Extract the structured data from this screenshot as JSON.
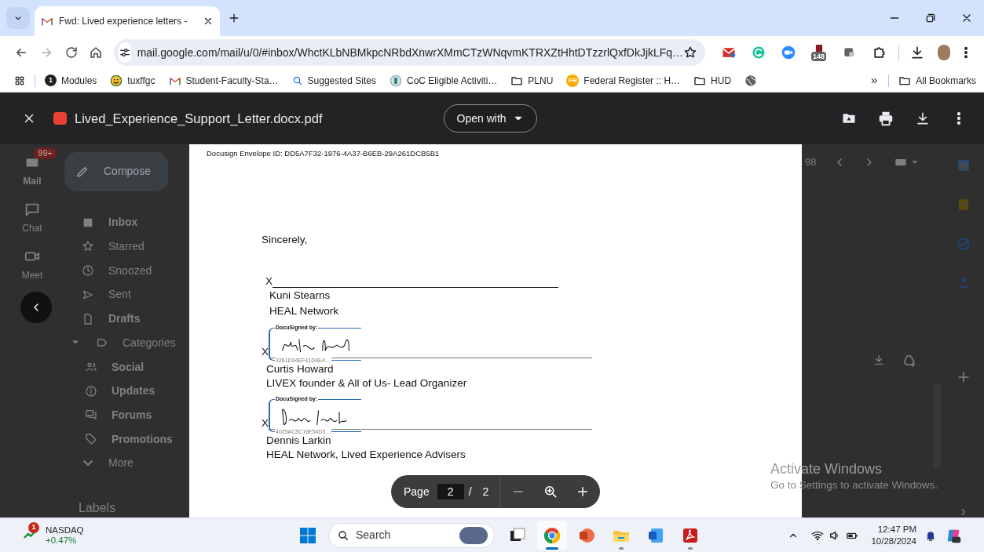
{
  "browser": {
    "tabs": [
      {
        "title": "Fwd: Lived experience letters -",
        "selected": true
      }
    ],
    "url": "mail.google.com/mail/u/0/#inbox/WhctKLbNBMkpcNRbdXnwrXMmCTzWNqvmKTRXZtHhtDTzzrlQxfDkJjkLFq…",
    "extensions": [
      {
        "kind": "mail"
      },
      {
        "kind": "grammarly"
      },
      {
        "kind": "zoom"
      },
      {
        "kind": "counter",
        "badge": "148"
      },
      {
        "kind": "tabs"
      },
      {
        "kind": "puzzle"
      }
    ],
    "bookmarks": [
      {
        "kind": "numbered",
        "icon_text": "1",
        "label": "Modules"
      },
      {
        "kind": "emoji",
        "label": "tuxffgc"
      },
      {
        "kind": "gmail",
        "label": "Student-Faculty-Sta…"
      },
      {
        "kind": "search",
        "label": "Suggested Sites"
      },
      {
        "kind": "site",
        "label": "CoC Eligible Activiti…"
      },
      {
        "kind": "folder",
        "label": "PLNU"
      },
      {
        "kind": "lettered",
        "icon_text": "FR",
        "label": "Federal Register :: H…"
      },
      {
        "kind": "folder",
        "label": "HUD"
      },
      {
        "kind": "globe"
      }
    ],
    "overflow": "»",
    "all_bookmarks": "All Bookmarks"
  },
  "viewer": {
    "filename": "Lived_Experience_Support_Letter.docx.pdf",
    "open_with": "Open with"
  },
  "gmail": {
    "rail": [
      {
        "kind": "mail",
        "label": "Mail",
        "badge": "99+"
      },
      {
        "kind": "chat",
        "label": "Chat"
      },
      {
        "kind": "meet",
        "label": "Meet"
      }
    ],
    "compose": "Compose",
    "nav": [
      {
        "kind": "inbox",
        "label": "Inbox",
        "unread": true
      },
      {
        "kind": "star",
        "label": "Starred",
        "unread": false
      },
      {
        "kind": "clock",
        "label": "Snoozed",
        "unread": false
      },
      {
        "kind": "send",
        "label": "Sent",
        "unread": false
      },
      {
        "kind": "file",
        "label": "Drafts",
        "unread": true
      },
      {
        "kind": "label",
        "label": "Categories",
        "unread": false,
        "expanded": true,
        "children": [
          {
            "kind": "people",
            "label": "Social",
            "unread": true
          },
          {
            "kind": "info",
            "label": "Updates",
            "unread": true
          },
          {
            "kind": "forum",
            "label": "Forums",
            "unread": true
          },
          {
            "kind": "tag",
            "label": "Promotions",
            "unread": true
          }
        ]
      },
      {
        "kind": "more",
        "label": "More",
        "unread": false
      }
    ],
    "labels_heading": "Labels",
    "count": "98"
  },
  "document": {
    "envelope_id": "Docusign Envelope ID: DD5A7F32-1976-4A37-B6EB-29A261DCB5B1",
    "closing": "Sincerely,",
    "signers": [
      {
        "mark": "X",
        "signed": false,
        "name": "Kuni Stearns",
        "title": "HEAL Network"
      },
      {
        "mark": "X",
        "signed": true,
        "stamp_label": "DocuSigned by:",
        "signer_id": "3261D94EF41D4E4…",
        "name": "Curtis Howard",
        "title": "LIVEX founder & All of Us- Lead Organizer"
      },
      {
        "mark": "X",
        "signed": true,
        "stamp_label": "DocuSigned by:",
        "signer_id": "4025AC5C16E54D3…",
        "name": "Dennis Larkin",
        "title": "HEAL Network, Lived Experience Advisers"
      }
    ]
  },
  "pager": {
    "label": "Page",
    "current": "2",
    "separator": "/",
    "total": "2"
  },
  "activation": {
    "title": "Activate Windows",
    "subtitle": "Go to Settings to activate Windows."
  },
  "taskbar": {
    "ticker": {
      "name": "NASDAQ",
      "change": "+0.47%",
      "badge": "1"
    },
    "search_placeholder": "Search",
    "apps": [
      {
        "kind": "taskview",
        "running": false,
        "selected": false
      },
      {
        "kind": "chrome",
        "running": true,
        "selected": true
      },
      {
        "kind": "powerpoint",
        "running": false,
        "selected": false
      },
      {
        "kind": "explorer",
        "running": true,
        "selected": false
      },
      {
        "kind": "word",
        "running": false,
        "selected": false
      },
      {
        "kind": "acrobat",
        "running": true,
        "selected": false
      }
    ],
    "time": "12:47 PM",
    "date": "10/28/2024"
  }
}
